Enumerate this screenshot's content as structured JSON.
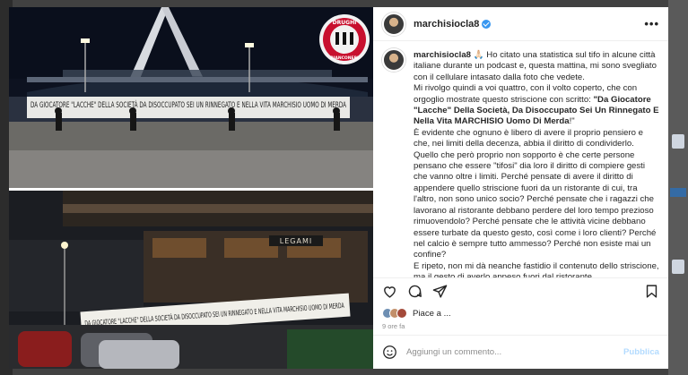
{
  "post": {
    "username": "marchisiocla8",
    "more_label": "•••",
    "caption": {
      "username": "marchisiocla8",
      "p1": "🙏🏻 Ho citato una statistica sul tifo in alcune città italiane durante un podcast e, questa mattina, mi sono svegliato con il cellulare intasato dalla foto che vedete.",
      "p2_pre": "Mi rivolgo quindi a voi quattro, con il volto coperto, che con orgoglio mostrate questo striscione con scritto: ",
      "p2_bold": "\"Da Giocatore \"Lacche\" Della Società, Da Disoccupato Sei Un Rinnegato E Nella Vita MARCHISIO Uomo Di Merda",
      "p2_post": "!\"",
      "p3": "È evidente che ognuno è libero di avere il proprio pensiero e che, nei limiti della decenza, abbia il diritto di condividerlo. Quello che però proprio non sopporto è che certe persone pensano che essere \"tifosi\" dia loro il diritto di compiere gesti che vanno oltre i limiti. Perché pensate di avere il diritto di appendere quello striscione fuori da un ristorante di cui, tra l'altro, non sono unico socio? Perché pensate che i ragazzi che lavorano al ristorante debbano perdere del loro tempo prezioso rimuovendolo? Perché pensate che le attività vicine debbano essere turbate da questo gesto, così come i loro clienti? Perché nel calcio è sempre tutto ammesso? Perché non esiste mai un confine?",
      "p4": "E ripeto, non mi dà neanche fastidio il contenuto dello striscione, ma il gesto di averlo appeso fuori dal ristorante."
    },
    "likes_text": "Piace a ...",
    "time": "9 ore fa",
    "comment_placeholder": "Aggiungi un commento...",
    "publish_label": "Pubblica"
  },
  "photo": {
    "logo_top": "DRUGHI",
    "logo_bottom": "BIANCONERI",
    "sign": "LEGAMI",
    "banner_top": "DA GIOCATORE \"LACCHE\" DELLA SOCIETÀ DA DISOCCUPATO SEI UN RINNEGATO E NELLA VITA MARCHISIO UOMO DI MERDA",
    "banner_bottom": "DA GIOCATORE \"LACCHE\" DELLA SOCIETÀ DA DISOCCUPATO SEI UN RINNEGATO E NELLA VITA MARCHISIO UOMO DI MERDA"
  },
  "icons": {
    "more": "more-horizontal-icon",
    "heart": "heart-icon",
    "comment": "comment-icon",
    "share": "share-icon",
    "bookmark": "bookmark-icon",
    "emoji": "emoji-icon"
  },
  "colors": {
    "verified": "#3897f0",
    "publish": "#b3dbff",
    "text": "#262626",
    "muted": "#8e8e8e"
  }
}
